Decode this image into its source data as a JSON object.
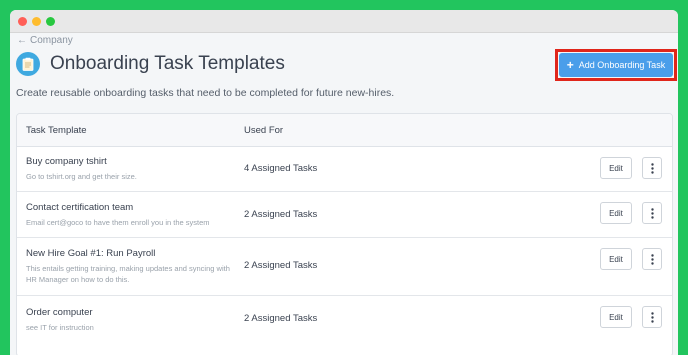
{
  "breadcrumb": {
    "label": "Company"
  },
  "header": {
    "title": "Onboarding Task Templates",
    "subtitle": "Create reusable onboarding tasks that need to be completed for future new-hires.",
    "add_button_label": "Add Onboarding Task"
  },
  "table": {
    "columns": [
      "Task Template",
      "Used For"
    ],
    "rows": [
      {
        "name": "Buy company tshirt",
        "description": "Go to tshirt.org and get their size.",
        "used_for": "4 Assigned Tasks",
        "edit_label": "Edit"
      },
      {
        "name": "Contact certification team",
        "description": "Email cert@goco to have them enroll you in the system",
        "used_for": "2 Assigned Tasks",
        "edit_label": "Edit"
      },
      {
        "name": "New Hire Goal #1: Run Payroll",
        "description": "This entails getting training, making updates and syncing with HR Manager on how to do this.",
        "used_for": "2 Assigned Tasks",
        "edit_label": "Edit"
      },
      {
        "name": "Order computer",
        "description": "see IT for instruction",
        "used_for": "2 Assigned Tasks",
        "edit_label": "Edit"
      }
    ]
  },
  "colors": {
    "background": "#22c55e",
    "accent": "#4a9eea",
    "highlight": "#e0261b"
  }
}
